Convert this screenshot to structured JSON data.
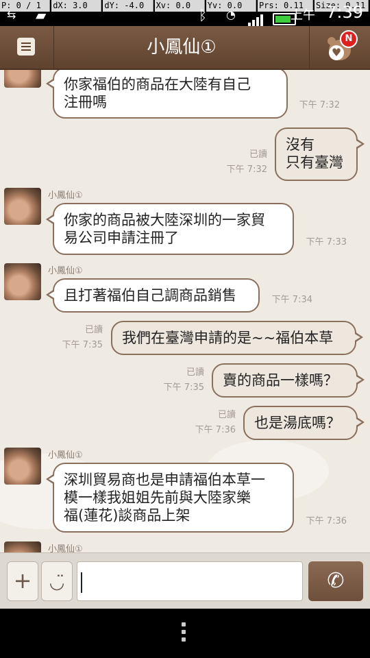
{
  "debug": [
    "P: 0 / 1",
    "dX: 3.0",
    "dY: -4.0",
    "Xv: 0.0",
    "Yv: 0.0",
    "Prs: 0.11",
    "Size: 0.11"
  ],
  "status": {
    "ampm": "上午",
    "time": "7:39"
  },
  "header": {
    "title": "小鳳仙①",
    "badge": "N"
  },
  "messages": [
    {
      "dir": "in",
      "sender": "",
      "text": "你家福伯的商品在大陸有自己\n注冊嗎",
      "time": "下午 7:32"
    },
    {
      "dir": "out",
      "read": "已讀",
      "text": "沒有\n只有臺灣",
      "time": "下午 7:32"
    },
    {
      "dir": "in",
      "sender": "小鳳仙①",
      "text": "你家的商品被大陸深圳的一家貿\n易公司申請注冊了",
      "time": "下午 7:33"
    },
    {
      "dir": "in",
      "sender": "小鳳仙①",
      "text": "且打著福伯自己調商品銷售",
      "time": "下午 7:34"
    },
    {
      "dir": "out",
      "read": "已讀",
      "text": "我們在臺灣申請的是~~福伯本草",
      "time": "下午 7:35"
    },
    {
      "dir": "out",
      "read": "已讀",
      "text": "賣的商品一樣嗎？",
      "time": "下午 7:35"
    },
    {
      "dir": "out",
      "read": "已讀",
      "text": "也是湯底嗎？",
      "time": "下午 7:36"
    },
    {
      "dir": "in",
      "sender": "小鳳仙①",
      "text": "深圳貿易商也是申請福伯本草一\n模一樣我姐姐先前與大陸家樂\n福(蓮花)談商品上架",
      "time": "下午 7:36"
    },
    {
      "dir": "in",
      "sender": "小鳳仙①",
      "text": "",
      "time": ""
    }
  ],
  "input": {
    "value": "",
    "placeholder": ""
  },
  "icons": {
    "menu": "menu-icon",
    "friend": "bear-heart-icon",
    "plus": "plus-icon",
    "emoji": "smiley-icon",
    "call": "phone-icon",
    "overflow": "overflow-dots-icon"
  },
  "colors": {
    "header": "#6b4c38",
    "bubble_border": "#8a6f5c",
    "background": "#efebe3"
  }
}
